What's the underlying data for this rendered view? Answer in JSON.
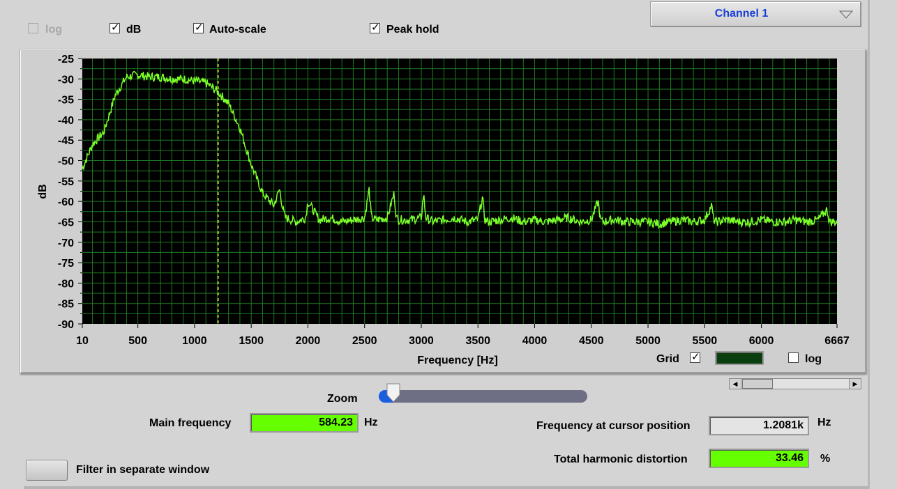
{
  "toolbar": {
    "log_label": "log",
    "db_label": "dB",
    "autoscale_label": "Auto-scale",
    "peakhold_label": "Peak hold",
    "log_checked": false,
    "db_checked": true,
    "autoscale_checked": true,
    "peakhold_checked": true
  },
  "channel": {
    "selected": "Channel 1"
  },
  "plot": {
    "grid_label": "Grid",
    "grid_checked": true,
    "grid_color": "#0b3f10",
    "log_label": "log",
    "log_checked": false,
    "background_color": "#000000",
    "trace_color": "#7cff2a",
    "cursor_color": "#f0f030"
  },
  "chart_data": {
    "type": "line",
    "title": "",
    "xlabel": "Frequency [Hz]",
    "ylabel": "dB",
    "xlim": [
      10,
      6667
    ],
    "ylim": [
      -90,
      -25
    ],
    "x_ticks": [
      "10",
      "500",
      "1000",
      "1500",
      "2000",
      "2500",
      "3000",
      "3500",
      "4000",
      "4500",
      "5000",
      "5500",
      "6000",
      "6667"
    ],
    "y_ticks": [
      "-25",
      "-30",
      "-35",
      "-40",
      "-45",
      "-50",
      "-55",
      "-60",
      "-65",
      "-70",
      "-75",
      "-80",
      "-85",
      "-90"
    ],
    "grid": true,
    "cursor_x": 1208.1,
    "series": [
      {
        "x": [
          10,
          100,
          200,
          300,
          400,
          500,
          600,
          700,
          800,
          900,
          1000,
          1100,
          1200,
          1300,
          1400,
          1500,
          1600,
          1700,
          1750,
          1780,
          1800,
          1900,
          1980,
          2000,
          2100,
          2200,
          2300,
          2400,
          2500,
          2540,
          2560,
          2600,
          2700,
          2760,
          2780,
          2800,
          2900,
          3000,
          3020,
          3040,
          3100,
          3200,
          3300,
          3400,
          3500,
          3540,
          3560,
          3600,
          3700,
          3800,
          3900,
          4000,
          4100,
          4200,
          4300,
          4400,
          4500,
          4560,
          4580,
          4600,
          4700,
          4800,
          4900,
          5000,
          5100,
          5200,
          5300,
          5400,
          5500,
          5560,
          5580,
          5600,
          5700,
          5800,
          5900,
          6000,
          6100,
          6200,
          6300,
          6400,
          6500,
          6580,
          6600,
          6667
        ],
        "y": [
          -52,
          -46,
          -43,
          -34,
          -29.5,
          -29,
          -29.5,
          -29.5,
          -30,
          -30,
          -30.5,
          -31,
          -33,
          -36,
          -42,
          -51,
          -58,
          -61,
          -57,
          -62,
          -64,
          -65,
          -64,
          -60,
          -64.5,
          -64,
          -65,
          -64.5,
          -64,
          -57,
          -64,
          -64.5,
          -64,
          -58,
          -64,
          -64.5,
          -64.5,
          -64,
          -58,
          -64,
          -65,
          -64.5,
          -64,
          -65,
          -64.5,
          -59,
          -64.5,
          -65,
          -64.5,
          -64,
          -65,
          -64.5,
          -65,
          -64.5,
          -64,
          -65,
          -64.5,
          -60,
          -64.5,
          -65,
          -64.5,
          -65,
          -65,
          -65,
          -65.5,
          -65,
          -64.5,
          -65,
          -64.5,
          -61,
          -64.5,
          -65,
          -64.5,
          -65,
          -65,
          -64.5,
          -65,
          -65,
          -64.5,
          -65,
          -64.5,
          -62,
          -65,
          -65
        ]
      }
    ]
  },
  "zoom": {
    "label": "Zoom",
    "value": 0.07
  },
  "main_frequency": {
    "label": "Main frequency",
    "value": "584.23",
    "unit": "Hz"
  },
  "cursor_frequency": {
    "label": "Frequency at cursor position",
    "value": "1.2081k",
    "unit": "Hz"
  },
  "thd": {
    "label": "Total harmonic distortion",
    "value": "33.46",
    "unit": "%"
  },
  "filter_button": {
    "label": "Filter in separate window"
  }
}
